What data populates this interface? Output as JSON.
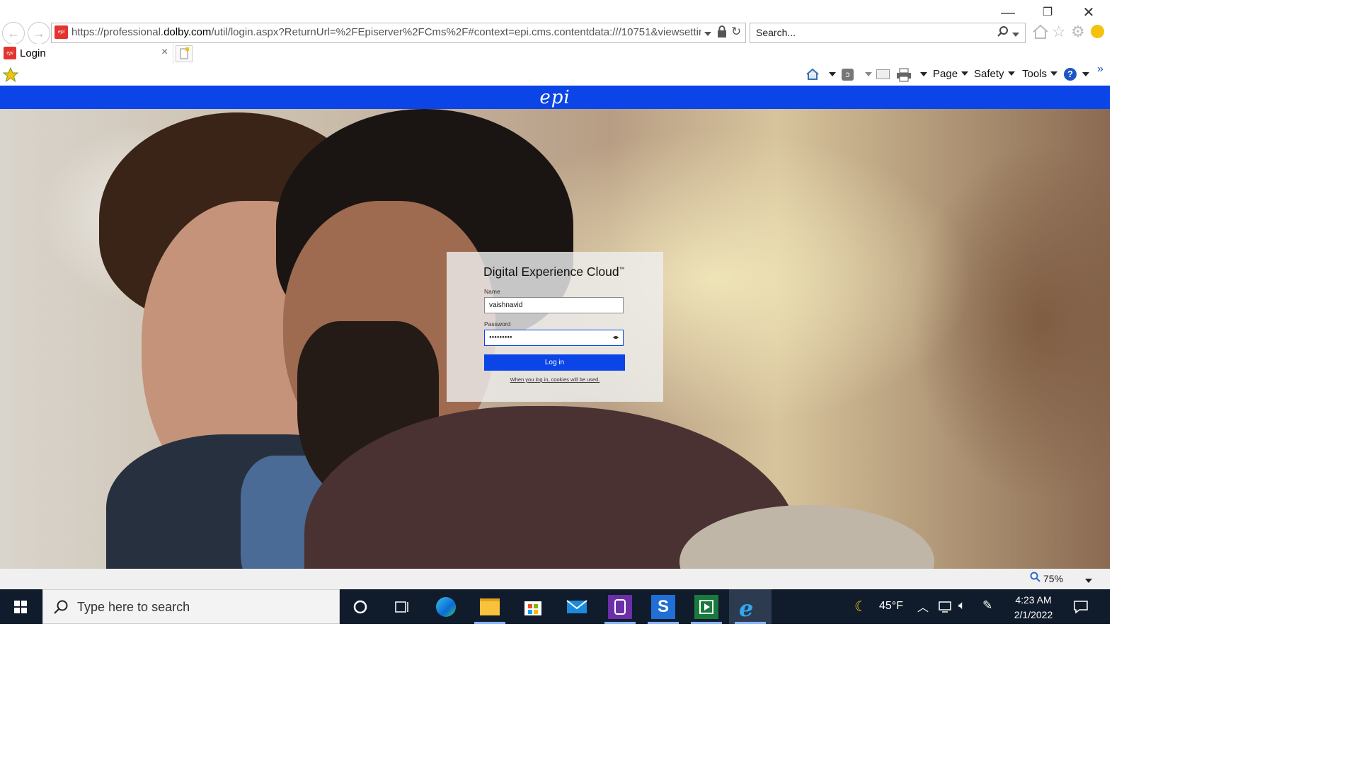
{
  "browser": {
    "url_prefix": "https://professional.",
    "url_domain": "dolby.com",
    "url_suffix": "/util/login.aspx?ReturnUrl=%2FEpiserver%2FCms%2F#context=epi.cms.contentdata:///10751&viewsetting=",
    "search_placeholder": "Search...",
    "tab_title": "Login",
    "tab_close": "×",
    "window_min": "—",
    "window_restore": "❐",
    "window_close": "✕",
    "favicon_text": "epi"
  },
  "command_bar": {
    "page": "Page",
    "safety": "Safety",
    "tools": "Tools",
    "help": "?",
    "chevron": "»"
  },
  "header": {
    "logo": "epi"
  },
  "login": {
    "title": "Digital Experience Cloud",
    "trademark": "™",
    "name_label": "Name",
    "name_value": "vaishnavid",
    "password_label": "Password",
    "password_mask": "●●●●●●●●●",
    "button": "Log in",
    "cookie_note": "When you log in, cookies will be used."
  },
  "status_bar": {
    "zoom": "75%"
  },
  "taskbar": {
    "search_placeholder": "Type here to search",
    "temperature": "45°F",
    "time": "4:23 AM",
    "date": "2/1/2022"
  },
  "colors": {
    "brand_blue": "#0b45e8",
    "taskbar_bg": "#101c2b"
  }
}
